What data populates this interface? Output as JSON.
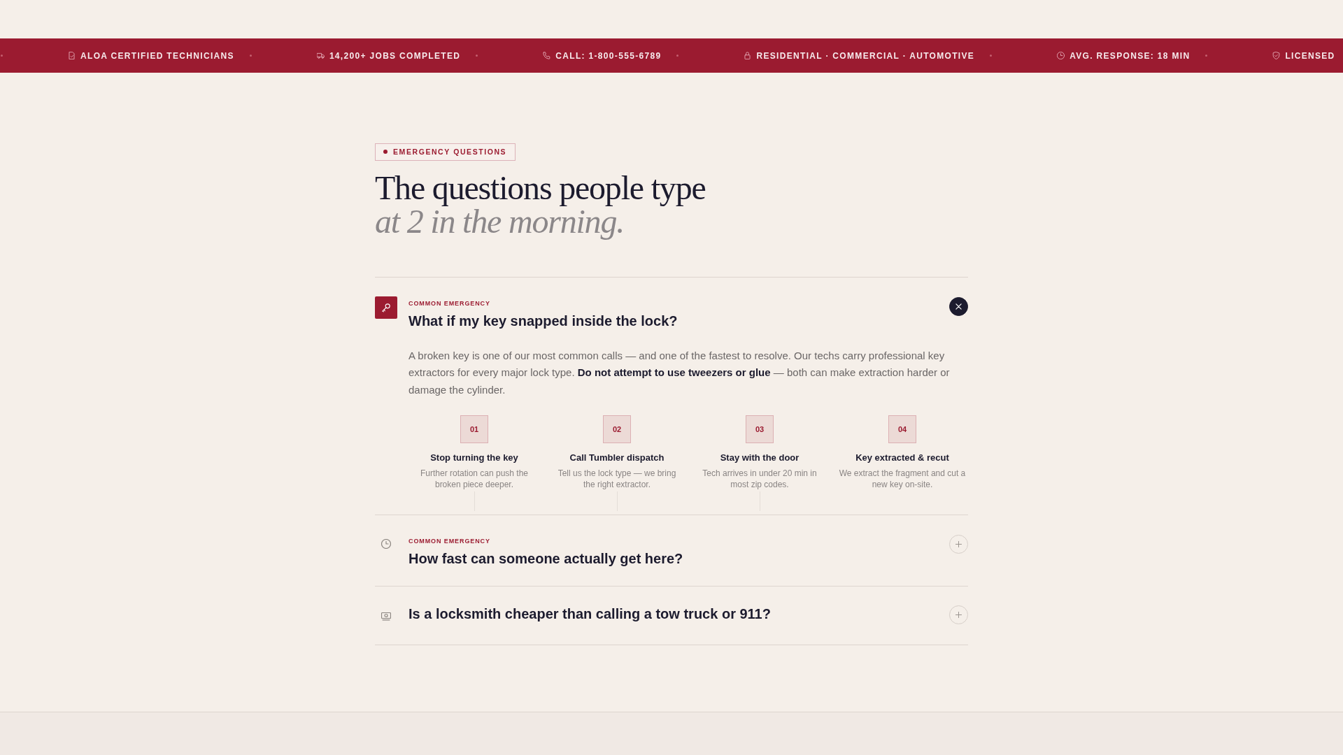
{
  "ticker": [
    "ALOA CERTIFIED TECHNICIANS",
    "14,200+ JOBS COMPLETED",
    "CALL: 1-800-555-6789",
    "RESIDENTIAL · COMMERCIAL · AUTOMOTIVE",
    "AVG. RESPONSE: 18 MIN",
    "LICENSED"
  ],
  "section": {
    "tag": "EMERGENCY QUESTIONS",
    "title": "The questions people type",
    "title_emphasis": "at 2 in the morning."
  },
  "faq": [
    {
      "label": "COMMON EMERGENCY",
      "question": "What if my key snapped inside the lock?",
      "expanded": true,
      "answer": "A broken key is one of our most common calls — and one of the fastest to resolve. Our techs carry professional key extractors for every major lock type. **Do not attempt to use tweezers or glue** — both can make extraction harder or damage the cylinder.",
      "steps": [
        {
          "number": "01",
          "title": "Stop turning the key",
          "text": "Further rotation can push the broken piece deeper."
        },
        {
          "number": "02",
          "title": "Call Tumbler dispatch",
          "text": "Tell us the lock type — we bring the right extractor."
        },
        {
          "number": "03",
          "title": "Stay with the door",
          "text": "Tech arrives in under 20 min in most zip codes."
        },
        {
          "number": "04",
          "title": "Key extracted & recut",
          "text": "We extract the fragment and cut a new key on-site."
        }
      ]
    },
    {
      "label": "COMMON EMERGENCY",
      "question": "How fast can someone actually get here?",
      "expanded": false
    },
    {
      "question": "Is a locksmith cheaper than calling a tow truck or 911?",
      "expanded": false
    }
  ]
}
